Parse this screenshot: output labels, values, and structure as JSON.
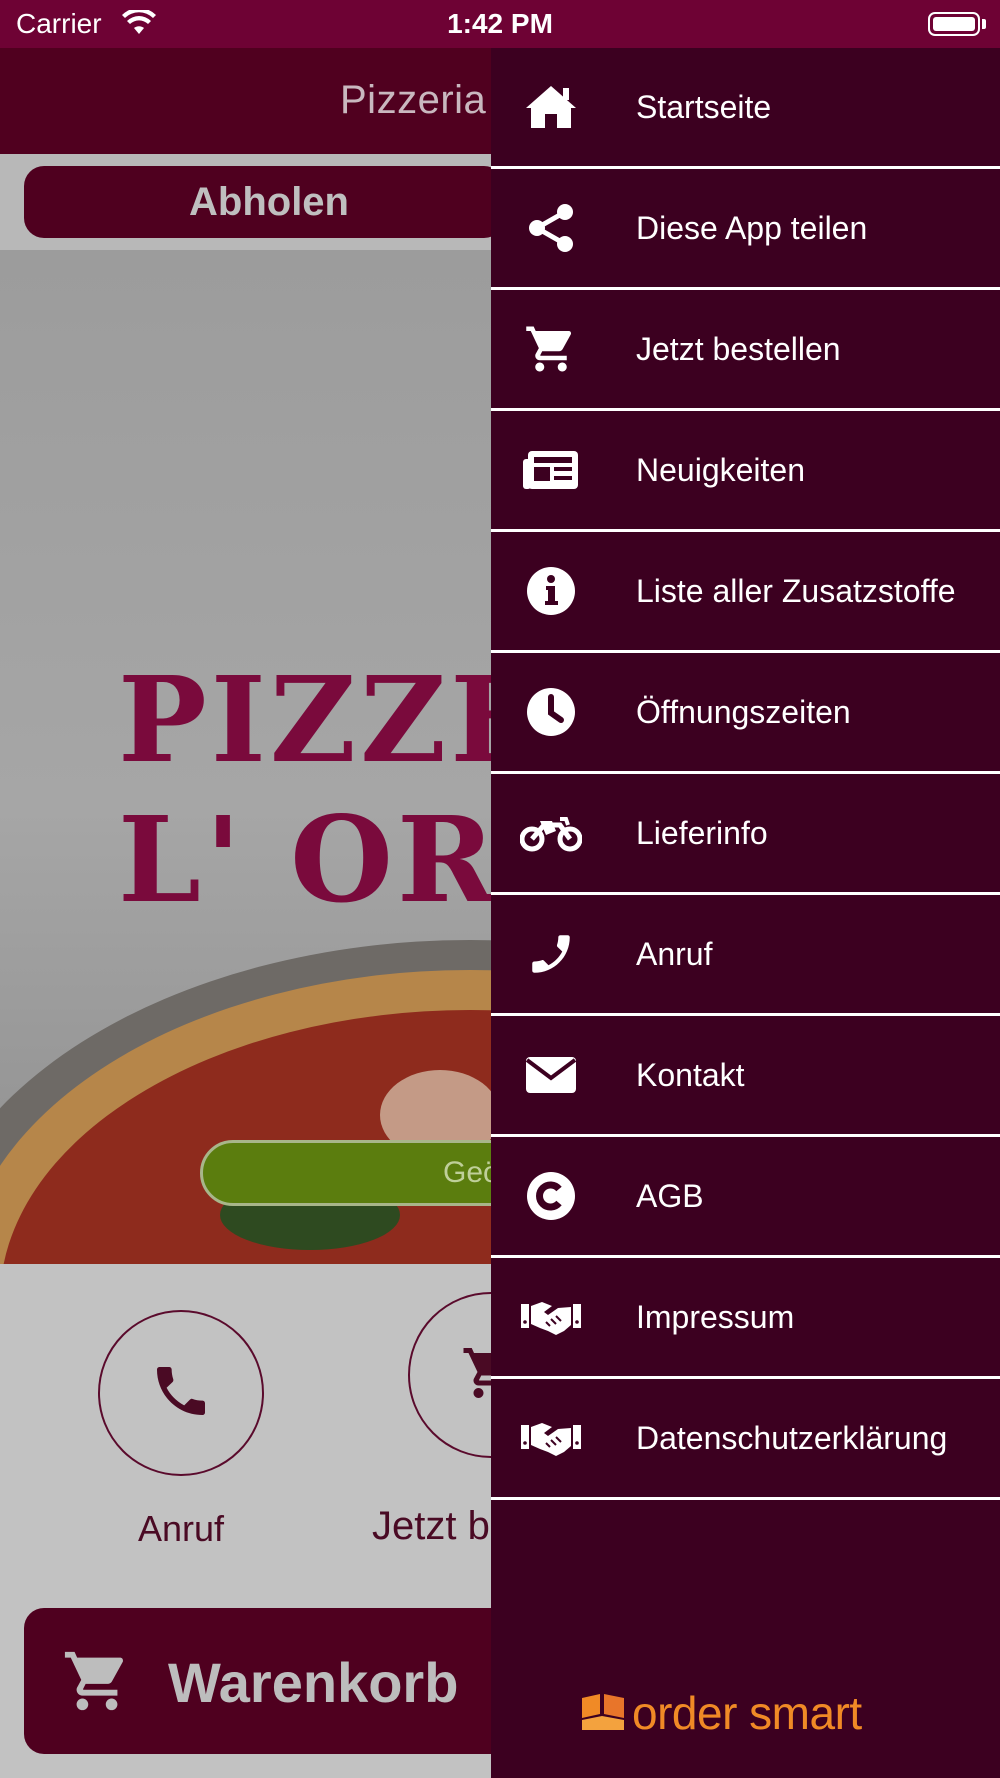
{
  "status_bar": {
    "carrier": "Carrier",
    "time": "1:42 PM"
  },
  "header": {
    "title": "Pizzeria L"
  },
  "order_mode": {
    "pickup_label": "Abholen"
  },
  "hero": {
    "logo_line1": "PIZZEI",
    "logo_line2": "L' ORC",
    "open_badge": "Geö"
  },
  "actions": {
    "call_label": "Anruf",
    "order_label": "Jetzt b"
  },
  "cart": {
    "label": "Warenkorb"
  },
  "drawer": {
    "items": [
      {
        "label": "Startseite",
        "icon": "home-icon"
      },
      {
        "label": "Diese App teilen",
        "icon": "share-icon"
      },
      {
        "label": "Jetzt bestellen",
        "icon": "cart-icon"
      },
      {
        "label": "Neuigkeiten",
        "icon": "newspaper-icon"
      },
      {
        "label": "Liste aller Zusatzstoffe",
        "icon": "info-icon"
      },
      {
        "label": "Öffnungszeiten",
        "icon": "clock-icon"
      },
      {
        "label": "Lieferinfo",
        "icon": "motorcycle-icon"
      },
      {
        "label": "Anruf",
        "icon": "phone-icon"
      },
      {
        "label": "Kontakt",
        "icon": "envelope-icon"
      },
      {
        "label": "AGB",
        "icon": "copyright-icon"
      },
      {
        "label": "Impressum",
        "icon": "handshake-icon"
      },
      {
        "label": "Datenschutzerklärung",
        "icon": "handshake-icon"
      }
    ],
    "brand": "order smart"
  },
  "colors": {
    "primary": "#50001f",
    "drawer_bg": "#3c0020",
    "status_bar": "#6e0234",
    "open_green": "#5b7d0e",
    "brand_orange": "#f08a26"
  }
}
